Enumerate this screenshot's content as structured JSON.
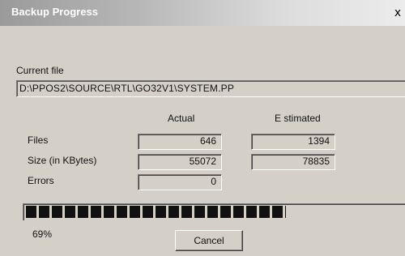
{
  "window": {
    "title": "Backup Progress",
    "close_glyph": "x"
  },
  "current_file": {
    "label": "Current file",
    "path": "D:\\PPOS2\\SOURCE\\RTL\\GO32V1\\SYSTEM.PP"
  },
  "columns": {
    "actual": "Actual",
    "estimated": "E stimated"
  },
  "rows": [
    {
      "label": "Files",
      "actual": "646",
      "estimated": "1394"
    },
    {
      "label": "Size (in KBytes)",
      "actual": "55072",
      "estimated": "78835"
    },
    {
      "label": "Errors",
      "actual": "0"
    }
  ],
  "progress": {
    "percent_text": "69%",
    "fraction": 0.69
  },
  "buttons": {
    "cancel": "Cancel"
  }
}
